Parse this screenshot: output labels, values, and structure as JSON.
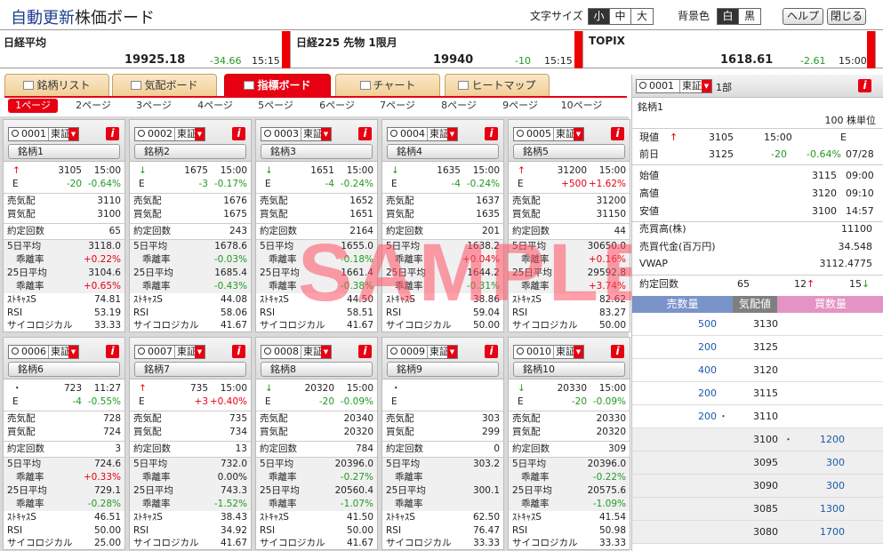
{
  "header": {
    "title_a": "自動更新",
    "title_b": "株価ボード",
    "font_label": "文字サイズ",
    "font_opts": [
      "小",
      "中",
      "大"
    ],
    "bg_label": "背景色",
    "bg_opts": [
      "白",
      "黒"
    ],
    "help": "ヘルプ",
    "close": "閉じる"
  },
  "indices": [
    {
      "name": "日経平均",
      "value": "19925.18",
      "change": "-34.66",
      "time": "15:15"
    },
    {
      "name": "日経225 先物 1限月",
      "value": "19940",
      "change": "-10",
      "time": "15:15"
    },
    {
      "name": "TOPIX",
      "value": "1618.61",
      "change": "-2.61",
      "time": "15:00"
    }
  ],
  "tabs": [
    "銘柄リスト",
    "気配ボード",
    "指標ボード",
    "チャート",
    "ヒートマップ"
  ],
  "pages": [
    "1ページ",
    "2ページ",
    "3ページ",
    "4ページ",
    "5ページ",
    "6ページ",
    "7ページ",
    "8ページ",
    "9ページ",
    "10ページ"
  ],
  "labels": {
    "sell": "売気配",
    "buy": "買気配",
    "count": "約定回数",
    "ma5": "5日平均",
    "dev": "乖離率",
    "ma25": "25日平均",
    "stoch": "ｽﾄｷｬｽS",
    "rsi": "RSI",
    "psy": "サイコロジカル",
    "info": "i"
  },
  "cards": [
    {
      "code": "0001",
      "mkt": "東証",
      "name": "銘柄1",
      "arrow": "↑",
      "ad": "up",
      "price": "3105",
      "time": "15:00",
      "flag": "E",
      "chg": "-20",
      "pct": "-0.64%",
      "cd": "dn",
      "sell": "3110",
      "buy": "3100",
      "count": "65",
      "ma5": "3118.0",
      "d5": "+0.22%",
      "d5c": "up",
      "ma25": "3104.6",
      "d25": "+0.65%",
      "d25c": "up",
      "stoch": "74.81",
      "rsi": "53.19",
      "psy": "33.33"
    },
    {
      "code": "0002",
      "mkt": "東証",
      "name": "銘柄2",
      "arrow": "↓",
      "ad": "dn",
      "price": "1675",
      "time": "15:00",
      "flag": "E",
      "chg": "-3",
      "pct": "-0.17%",
      "cd": "dn",
      "sell": "1676",
      "buy": "1675",
      "count": "243",
      "ma5": "1678.6",
      "d5": "-0.03%",
      "d5c": "dn",
      "ma25": "1685.4",
      "d25": "-0.43%",
      "d25c": "dn",
      "stoch": "44.08",
      "rsi": "58.06",
      "psy": "41.67"
    },
    {
      "code": "0003",
      "mkt": "東証",
      "name": "銘柄3",
      "arrow": "↓",
      "ad": "dn",
      "price": "1651",
      "time": "15:00",
      "flag": "E",
      "chg": "-4",
      "pct": "-0.24%",
      "cd": "dn",
      "sell": "1652",
      "buy": "1651",
      "count": "2164",
      "ma5": "1655.0",
      "d5": "-0.18%",
      "d5c": "dn",
      "ma25": "1661.4",
      "d25": "-0.38%",
      "d25c": "dn",
      "stoch": "44.50",
      "rsi": "58.51",
      "psy": "41.67"
    },
    {
      "code": "0004",
      "mkt": "東証",
      "name": "銘柄4",
      "arrow": "↓",
      "ad": "dn",
      "price": "1635",
      "time": "15:00",
      "flag": "E",
      "chg": "-4",
      "pct": "-0.24%",
      "cd": "dn",
      "sell": "1637",
      "buy": "1635",
      "count": "201",
      "ma5": "1638.2",
      "d5": "+0.04%",
      "d5c": "up",
      "ma25": "1644.2",
      "d25": "-0.31%",
      "d25c": "dn",
      "stoch": "38.86",
      "rsi": "59.04",
      "psy": "50.00"
    },
    {
      "code": "0005",
      "mkt": "東証",
      "name": "銘柄5",
      "arrow": "↑",
      "ad": "up",
      "price": "31200",
      "time": "15:00",
      "flag": "E",
      "chg": "+500",
      "pct": "+1.62%",
      "cd": "up",
      "sell": "31200",
      "buy": "31150",
      "count": "44",
      "ma5": "30650.0",
      "d5": "+0.16%",
      "d5c": "up",
      "ma25": "29592.8",
      "d25": "+3.74%",
      "d25c": "up",
      "stoch": "82.62",
      "rsi": "83.27",
      "psy": "50.00"
    },
    {
      "code": "0006",
      "mkt": "東証",
      "name": "銘柄6",
      "arrow": "・",
      "ad": "",
      "price": "723",
      "time": "11:27",
      "flag": "E",
      "chg": "-4",
      "pct": "-0.55%",
      "cd": "dn",
      "sell": "728",
      "buy": "724",
      "count": "3",
      "ma5": "724.6",
      "d5": "+0.33%",
      "d5c": "up",
      "ma25": "729.1",
      "d25": "-0.28%",
      "d25c": "dn",
      "stoch": "46.51",
      "rsi": "50.00",
      "psy": "25.00"
    },
    {
      "code": "0007",
      "mkt": "東証",
      "name": "銘柄7",
      "arrow": "↑",
      "ad": "up",
      "price": "735",
      "time": "15:00",
      "flag": "E",
      "chg": "+3",
      "pct": "+0.40%",
      "cd": "up",
      "sell": "735",
      "buy": "734",
      "count": "13",
      "ma5": "732.0",
      "d5": "0.00%",
      "d5c": "",
      "ma25": "743.3",
      "d25": "-1.52%",
      "d25c": "dn",
      "stoch": "38.43",
      "rsi": "34.92",
      "psy": "41.67"
    },
    {
      "code": "0008",
      "mkt": "東証",
      "name": "銘柄8",
      "arrow": "↓",
      "ad": "dn",
      "price": "20320",
      "time": "15:00",
      "flag": "E",
      "chg": "-20",
      "pct": "-0.09%",
      "cd": "dn",
      "sell": "20340",
      "buy": "20320",
      "count": "784",
      "ma5": "20396.0",
      "d5": "-0.27%",
      "d5c": "dn",
      "ma25": "20560.4",
      "d25": "-1.07%",
      "d25c": "dn",
      "stoch": "41.50",
      "rsi": "50.00",
      "psy": "41.67"
    },
    {
      "code": "0009",
      "mkt": "東証",
      "name": "銘柄9",
      "arrow": "・",
      "ad": "",
      "price": "",
      "time": "",
      "flag": "E",
      "chg": "",
      "pct": "",
      "cd": "",
      "sell": "303",
      "buy": "299",
      "count": "0",
      "ma5": "303.2",
      "d5": "",
      "d5c": "",
      "ma25": "300.1",
      "d25": "",
      "d25c": "",
      "stoch": "62.50",
      "rsi": "76.47",
      "psy": "33.33"
    },
    {
      "code": "0010",
      "mkt": "東証",
      "name": "銘柄10",
      "arrow": "↓",
      "ad": "dn",
      "price": "20330",
      "time": "15:00",
      "flag": "E",
      "chg": "-20",
      "pct": "-0.09%",
      "cd": "dn",
      "sell": "20330",
      "buy": "20320",
      "count": "309",
      "ma5": "20396.0",
      "d5": "-0.22%",
      "d5c": "dn",
      "ma25": "20575.6",
      "d25": "-1.09%",
      "d25c": "dn",
      "stoch": "41.54",
      "rsi": "50.98",
      "psy": "33.33"
    }
  ],
  "side": {
    "code": "0001",
    "mkt": "東証",
    "section": "1部",
    "name": "銘柄1",
    "unit": "100 株単位",
    "cur_label": "現値",
    "cur_arrow": "↑",
    "cur": "3105",
    "cur_time": "15:00",
    "cur_flag": "E",
    "prev_label": "前日",
    "prev": "3125",
    "prev_chg": "-20",
    "prev_pct": "-0.64%",
    "prev_date": "07/28",
    "open_label": "始値",
    "open": "3115",
    "open_t": "09:00",
    "high_label": "高値",
    "high": "3120",
    "high_t": "09:10",
    "low_label": "安値",
    "low": "3100",
    "low_t": "14:57",
    "vol_label": "売買高(株)",
    "vol": "11100",
    "amt_label": "売買代金(百万円)",
    "amt": "34.548",
    "vwap_label": "VWAP",
    "vwap": "3112.4775",
    "cnt_label": "約定回数",
    "cnt": "65",
    "cnt_up": "12",
    "cnt_up_a": "↑",
    "cnt_dn": "15",
    "cnt_dn_a": "↓",
    "book_h": [
      "売数量",
      "気配値",
      "買数量"
    ],
    "asks": [
      {
        "q": "500",
        "p": "3130",
        "m": ""
      },
      {
        "q": "200",
        "p": "3125",
        "m": ""
      },
      {
        "q": "400",
        "p": "3120",
        "m": ""
      },
      {
        "q": "200",
        "p": "3115",
        "m": ""
      },
      {
        "q": "200",
        "p": "3110",
        "m": "・"
      }
    ],
    "bids": [
      {
        "p": "3100",
        "q": "1200",
        "m": "・"
      },
      {
        "p": "3095",
        "q": "300",
        "m": ""
      },
      {
        "p": "3090",
        "q": "300",
        "m": ""
      },
      {
        "p": "3085",
        "q": "1300",
        "m": ""
      },
      {
        "p": "3080",
        "q": "1700",
        "m": ""
      }
    ]
  },
  "watermark": "SAMPLE"
}
